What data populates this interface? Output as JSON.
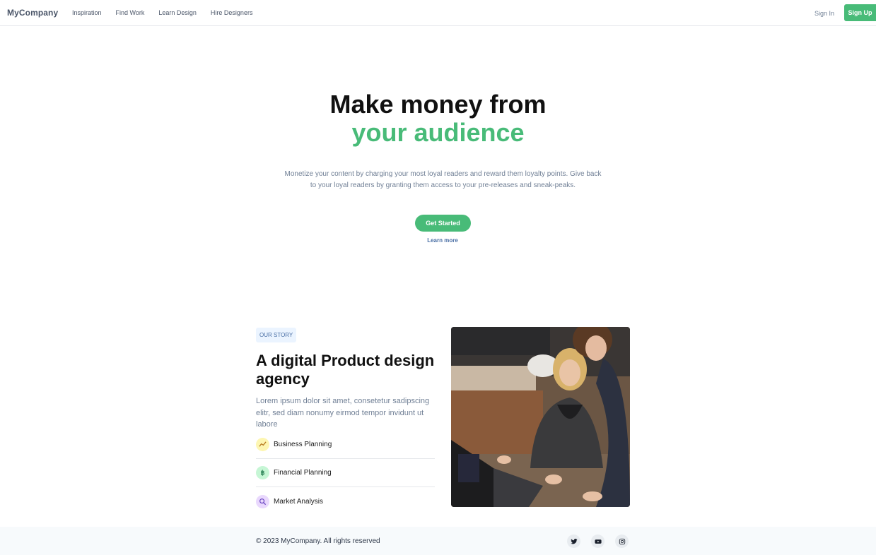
{
  "header": {
    "brand": "MyCompany",
    "nav": [
      "Inspiration",
      "Find Work",
      "Learn Design",
      "Hire Designers"
    ],
    "sign_in": "Sign In",
    "sign_up": "Sign Up"
  },
  "hero": {
    "title_line1": "Make money from",
    "title_line2": "your audience",
    "subtitle": "Monetize your content by charging your most loyal readers and reward them loyalty points. Give back to your loyal readers by granting them access to your pre-releases and sneak-peaks.",
    "cta": "Get Started",
    "learn_more": "Learn more"
  },
  "story": {
    "badge": "OUR STORY",
    "title": "A digital Product design agency",
    "text": "Lorem ipsum dolor sit amet, consetetur sadipscing elitr, sed diam nonumy eirmod tempor invidunt ut labore",
    "features": [
      {
        "label": "Business Planning",
        "icon": "trend-icon"
      },
      {
        "label": "Financial Planning",
        "icon": "bitcoin-icon"
      },
      {
        "label": "Market Analysis",
        "icon": "search-icon"
      }
    ]
  },
  "footer": {
    "copyright": "© 2023 MyCompany. All rights reserved",
    "socials": [
      "twitter-icon",
      "youtube-icon",
      "instagram-icon"
    ]
  },
  "colors": {
    "accent": "#48bb78",
    "link": "#4a6fa5",
    "muted": "#718096"
  }
}
